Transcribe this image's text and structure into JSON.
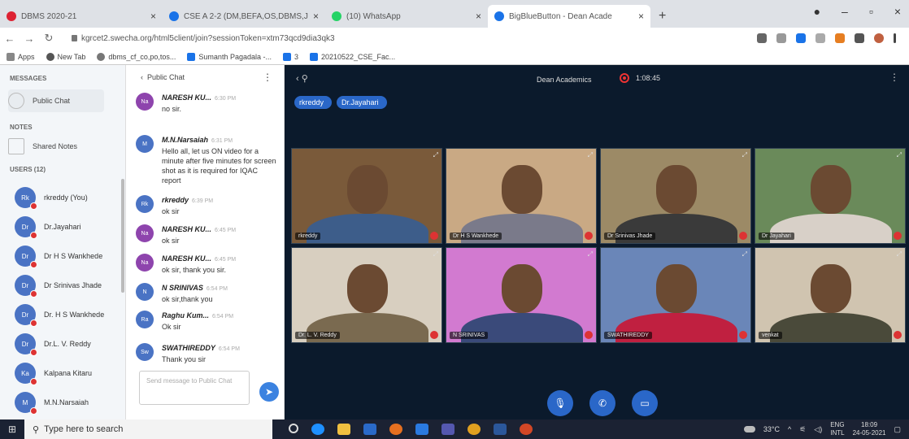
{
  "browser": {
    "tabs": [
      {
        "title": "DBMS 2020-21",
        "color": "#d23"
      },
      {
        "title": "CSE A 2-2 (DM,BEFA,OS,DBMS,J",
        "color": "#1a73e8"
      },
      {
        "title": "(10) WhatsApp",
        "color": "#25d366"
      },
      {
        "title": "BigBlueButton - Dean Acade",
        "color": "#1a73e8"
      }
    ],
    "url": "kgrcet2.swecha.org/html5client/join?sessionToken=xtm73qcd9dia3qk3",
    "bookmarks": [
      {
        "label": "Apps",
        "color": "#888"
      },
      {
        "label": "New Tab",
        "color": "#555"
      },
      {
        "label": "dbms_cf_co,po,tos...",
        "color": "#777"
      },
      {
        "label": "Sumanth Pagadala -...",
        "color": "#1a73e8"
      },
      {
        "label": "3",
        "color": "#1a73e8"
      },
      {
        "label": "20210522_CSE_Fac...",
        "color": "#1a73e8"
      }
    ]
  },
  "sidebar": {
    "messages_title": "MESSAGES",
    "public_chat": "Public Chat",
    "notes_title": "NOTES",
    "shared_notes": "Shared Notes",
    "users_title": "USERS (12)",
    "users": [
      {
        "initials": "Rk",
        "name": "rkreddy (You)",
        "color": "#4a73c4"
      },
      {
        "initials": "Dr",
        "name": "Dr.Jayahari",
        "color": "#4a73c4"
      },
      {
        "initials": "Dr",
        "name": "Dr H S Wankhede",
        "color": "#4a73c4"
      },
      {
        "initials": "Dr",
        "name": "Dr Srinivas Jhade",
        "color": "#4a73c4"
      },
      {
        "initials": "Dr",
        "name": "Dr. H S Wankhede",
        "color": "#4a73c4"
      },
      {
        "initials": "Dr",
        "name": "Dr.L. V. Reddy",
        "color": "#4a73c4"
      },
      {
        "initials": "Ka",
        "name": "Kalpana Kitaru",
        "color": "#4a73c4"
      },
      {
        "initials": "M",
        "name": "M.N.Narsaiah",
        "color": "#4a73c4"
      }
    ]
  },
  "chat": {
    "title": "Public Chat",
    "messages": [
      {
        "initials": "Na",
        "name": "NARESH KU...",
        "time": "6:30 PM",
        "text": "no sir.",
        "color": "#8e44ad"
      },
      {
        "initials": "M",
        "name": "M.N.Narsaiah",
        "time": "6:31 PM",
        "text": "Hello all, let us ON video for a minute after five minutes for screen shot as it is required for IQAC report",
        "color": "#4a73c4"
      },
      {
        "initials": "Rk",
        "name": "rkreddy",
        "time": "6:39 PM",
        "text": "ok sir",
        "color": "#4a73c4"
      },
      {
        "initials": "Na",
        "name": "NARESH KU...",
        "time": "6:45 PM",
        "text": "ok sir",
        "color": "#8e44ad"
      },
      {
        "initials": "Na",
        "name": "NARESH KU...",
        "time": "6:45 PM",
        "text": "ok sir, thank you sir.",
        "color": "#8e44ad"
      },
      {
        "initials": "N",
        "name": "N SRINIVAS",
        "time": "6:54 PM",
        "text": "ok sir,thank you",
        "color": "#4a73c4"
      },
      {
        "initials": "Ra",
        "name": "Raghu Kum...",
        "time": "6:54 PM",
        "text": "Ok sir",
        "color": "#4a73c4"
      },
      {
        "initials": "Sw",
        "name": "SWATHIREDDY",
        "time": "6:54 PM",
        "text": "Thank you sir",
        "color": "#4a73c4"
      }
    ],
    "composer_placeholder": "Send message to Public Chat"
  },
  "meeting": {
    "presenter": "Dean Academics",
    "timer": "1:08:45",
    "presenters": [
      "rkreddy",
      "Dr.Jayahari"
    ],
    "videos": [
      {
        "label": "rkreddy",
        "bg": "#7a5a3a",
        "shirt": "#3d5d8a"
      },
      {
        "label": "Dr H S Wankhede",
        "bg": "#c9a984",
        "shirt": "#7a7a8a"
      },
      {
        "label": "Dr Srinivas Jhade",
        "bg": "#9c8a66",
        "shirt": "#3a3a3a"
      },
      {
        "label": "Dr Jayahari",
        "bg": "#6a8a5a",
        "shirt": "#d8d0c8"
      },
      {
        "label": "Dr. L. V. Reddy",
        "bg": "#d8cfc0",
        "shirt": "#7a6a50"
      },
      {
        "label": "N SRINIVAS",
        "bg": "#d27ad0",
        "shirt": "#3a4a7a"
      },
      {
        "label": "SWATHIREDDY",
        "bg": "#6a86b8",
        "shirt": "#c02040"
      },
      {
        "label": "venkat",
        "bg": "#d0c4b0",
        "shirt": "#4a4a3a"
      }
    ]
  },
  "taskbar": {
    "search": "Type here to search",
    "weather": "33°C",
    "lang1": "ENG",
    "lang2": "INTL",
    "time": "18:09",
    "date": "24-05-2021"
  }
}
